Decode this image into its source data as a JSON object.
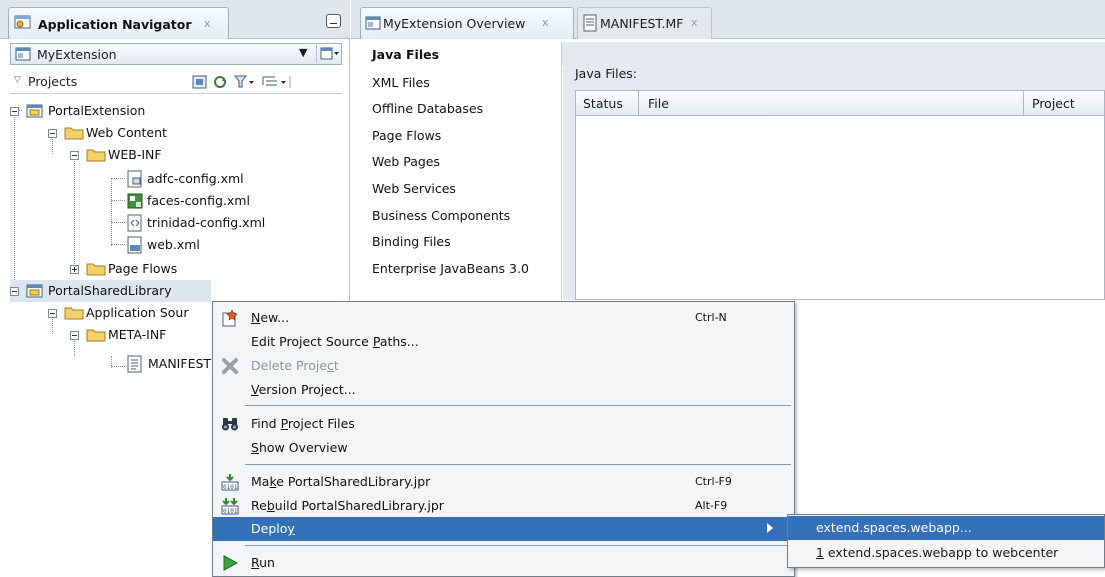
{
  "navigator": {
    "title": "Application Navigator",
    "close": "x",
    "application": "MyExtension",
    "projects_label": "Projects"
  },
  "tree": [
    {
      "label": "PortalExtension",
      "icon": "project-icon"
    },
    {
      "label": "Web Content",
      "icon": "folder-icon"
    },
    {
      "label": "WEB-INF",
      "icon": "folder-icon"
    },
    {
      "label": "adfc-config.xml",
      "icon": "adfc-config-icon"
    },
    {
      "label": "faces-config.xml",
      "icon": "faces-config-icon"
    },
    {
      "label": "trinidad-config.xml",
      "icon": "xml-file-icon"
    },
    {
      "label": "web.xml",
      "icon": "web-xml-icon"
    },
    {
      "label": "Page Flows",
      "icon": "folder-icon"
    },
    {
      "label": "PortalSharedLibrary",
      "icon": "project-icon"
    },
    {
      "label": "Application Sour",
      "icon": "folder-icon"
    },
    {
      "label": "META-INF",
      "icon": "folder-icon"
    },
    {
      "label": "MANIFEST",
      "icon": "text-file-icon"
    }
  ],
  "editor_tabs": [
    {
      "label": "MyExtension Overview",
      "close": "x"
    },
    {
      "label": "MANIFEST.MF",
      "close": "x"
    }
  ],
  "categories": [
    "Java Files",
    "XML Files",
    "Offline Databases",
    "Page Flows",
    "Web Pages",
    "Web Services",
    "Business Components",
    "Binding Files",
    "Enterprise JavaBeans 3.0"
  ],
  "files": {
    "label": "Java Files:",
    "columns": [
      "Status",
      "File",
      "Project"
    ]
  },
  "context_menu": {
    "new": {
      "pre": "",
      "u": "N",
      "post": "ew...",
      "shortcut": "Ctrl-N"
    },
    "edit_paths": {
      "pre": "Edit Project Source ",
      "u": "P",
      "post": "aths..."
    },
    "delete": {
      "pre": "Delete Proje",
      "u": "c",
      "post": "t"
    },
    "version": {
      "pre": "",
      "u": "V",
      "post": "ersion Project..."
    },
    "find": {
      "pre": "Find ",
      "u": "P",
      "post": "roject Files"
    },
    "overview": {
      "pre": "",
      "u": "S",
      "post": "how Overview"
    },
    "make": {
      "pre": "Ma",
      "u": "k",
      "post": "e PortalSharedLibrary.jpr",
      "shortcut": "Ctrl-F9"
    },
    "rebuild": {
      "pre": "Re",
      "u": "b",
      "post": "uild PortalSharedLibrary.jpr",
      "shortcut": "Alt-F9"
    },
    "deploy": {
      "pre": "Deplo",
      "u": "y",
      "post": ""
    },
    "run": {
      "pre": "",
      "u": "R",
      "post": "un"
    }
  },
  "deploy_submenu": {
    "item1": "extend.spaces.webapp...",
    "item2_num": "1",
    "item2_rest": " extend.spaces.webapp to webcenter"
  },
  "colors": {
    "highlight": "#3470b8",
    "panel": "#dfe6ee"
  }
}
